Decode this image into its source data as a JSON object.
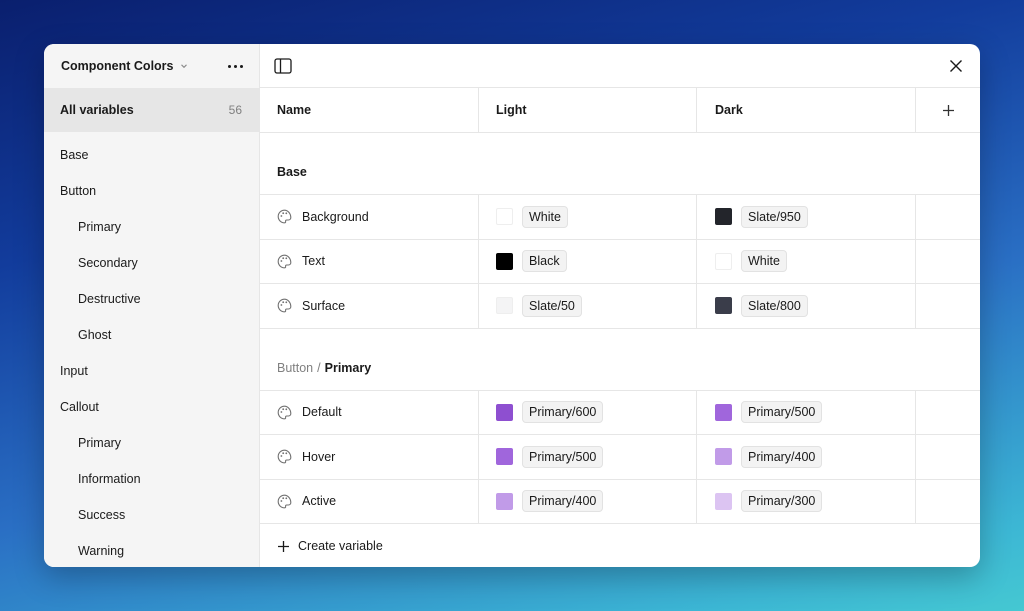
{
  "sidebar": {
    "collection_title": "Component Colors",
    "all_variables_label": "All variables",
    "all_variables_count": "56",
    "items": [
      {
        "label": "Base",
        "sub": false
      },
      {
        "label": "Button",
        "sub": false
      },
      {
        "label": "Primary",
        "sub": true
      },
      {
        "label": "Secondary",
        "sub": true
      },
      {
        "label": "Destructive",
        "sub": true
      },
      {
        "label": "Ghost",
        "sub": true
      },
      {
        "label": "Input",
        "sub": false
      },
      {
        "label": "Callout",
        "sub": false
      },
      {
        "label": "Primary",
        "sub": true
      },
      {
        "label": "Information",
        "sub": true
      },
      {
        "label": "Success",
        "sub": true
      },
      {
        "label": "Warning",
        "sub": true
      }
    ]
  },
  "table": {
    "columns": {
      "name": "Name",
      "light": "Light",
      "dark": "Dark"
    },
    "groups": [
      {
        "crumb": "",
        "title": "Base",
        "rows": [
          {
            "name": "Background",
            "light": {
              "label": "White",
              "color": "#ffffff"
            },
            "dark": {
              "label": "Slate/950",
              "color": "#23252b"
            }
          },
          {
            "name": "Text",
            "light": {
              "label": "Black",
              "color": "#000000"
            },
            "dark": {
              "label": "White",
              "color": "#ffffff"
            }
          },
          {
            "name": "Surface",
            "light": {
              "label": "Slate/50",
              "color": "#f4f4f5"
            },
            "dark": {
              "label": "Slate/800",
              "color": "#3a3d4a"
            }
          }
        ]
      },
      {
        "crumb": "Button",
        "title": "Primary",
        "rows": [
          {
            "name": "Default",
            "light": {
              "label": "Primary/600",
              "color": "#8e4fd0"
            },
            "dark": {
              "label": "Primary/500",
              "color": "#a066dc"
            }
          },
          {
            "name": "Hover",
            "light": {
              "label": "Primary/500",
              "color": "#a066dc"
            },
            "dark": {
              "label": "Primary/400",
              "color": "#c19be8"
            }
          },
          {
            "name": "Active",
            "light": {
              "label": "Primary/400",
              "color": "#c19be8"
            },
            "dark": {
              "label": "Primary/300",
              "color": "#dcc4f2"
            }
          }
        ]
      }
    ],
    "create_label": "Create variable"
  },
  "icons": {
    "collection_chevron": "chevron-down-icon",
    "more": "more-horizontal-icon",
    "panel_toggle": "sidebar-panel-icon",
    "close": "close-icon",
    "add_mode": "plus-icon",
    "variable_type": "palette-icon",
    "create": "plus-icon"
  }
}
